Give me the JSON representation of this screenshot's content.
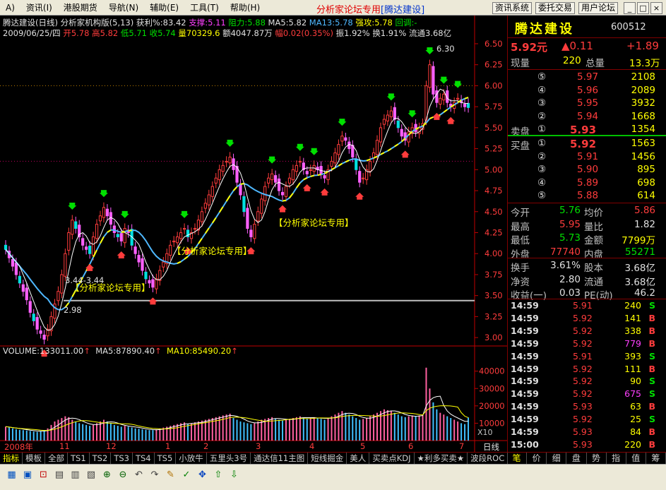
{
  "menu": {
    "items": [
      "A)",
      "资讯(I)",
      "港股期货",
      "导航(N)",
      "辅助(E)",
      "工具(T)",
      "帮助(H)"
    ],
    "title": "分析家论坛专用",
    "title_symbol": "[腾达建设]",
    "right_buttons": [
      "资讯系统",
      "委托交易",
      "用户论坛"
    ],
    "window_buttons": [
      "_",
      "□",
      "×"
    ]
  },
  "chart_info": {
    "name_period": "腾达建设(日线)",
    "indicator": "分析家机构版(5,13)",
    "profit": "获利%:83.42",
    "support": "支撑:5.11",
    "resistance": "阻力:5.88",
    "ma5": "MA5:5.82",
    "ma13": "MA13:5.78",
    "strong": "强攻:5.78",
    "pullback": "回调:-",
    "date": "2009/06/25/四",
    "open": "开5.78",
    "high": "高5.82",
    "low": "低5.71",
    "close": "收5.74",
    "volume": "量70329.6",
    "amount": "额4047.87万",
    "range": "幅0.02(0.35%)",
    "amp": "振1.92%",
    "turnover": "换1.91%",
    "float": "流通3.68亿"
  },
  "annotations": {
    "top_label": "6.30",
    "low_label": "2.98",
    "line_label": "3.44-3.44",
    "forum1": "【分析家论坛专用】",
    "forum2": "【分析家论坛专用】",
    "forum3": "【分析家论坛专用】"
  },
  "volume_info": {
    "volume": "VOLUME:133011.00",
    "ma5": "MA5:87890.40",
    "ma10": "MA10:85490.20"
  },
  "vol_multiplier": "X10",
  "date_axis": [
    "2008年",
    "11",
    "12",
    "1",
    "2",
    "3",
    "4",
    "5",
    "6",
    "7"
  ],
  "date_axis_right": "日线",
  "colors": {
    "up": "#ff3c3c",
    "down": "#00e000",
    "ma5": "#ffffff",
    "ma13": "#ffff00",
    "ma_support": "#4fb8ff",
    "axis": "#c00000"
  },
  "chart_data": {
    "type": "candlestick",
    "ylim": [
      2.9,
      6.55
    ],
    "yticks": [
      3.0,
      3.25,
      3.5,
      3.75,
      4.0,
      4.25,
      4.5,
      4.75,
      5.0,
      5.25,
      5.5,
      5.75,
      6.0,
      6.25,
      6.5
    ],
    "vol_yticks": [
      10000,
      20000,
      30000,
      40000
    ],
    "vol_ylim": [
      0,
      48000
    ],
    "horizontal_line": 3.44,
    "closes": [
      4.05,
      3.95,
      3.85,
      3.75,
      3.65,
      3.55,
      3.45,
      3.3,
      3.2,
      3.1,
      3.05,
      2.98,
      3.1,
      3.25,
      3.4,
      3.55,
      3.75,
      4.0,
      4.25,
      4.4,
      4.3,
      4.2,
      4.1,
      4.05,
      4.0,
      4.2,
      4.35,
      4.45,
      4.55,
      4.45,
      4.35,
      4.25,
      4.2,
      4.15,
      4.3,
      4.25,
      4.1,
      4.0,
      3.9,
      3.8,
      3.7,
      3.65,
      3.6,
      3.7,
      3.8,
      3.9,
      4.0,
      4.1,
      4.15,
      4.2,
      4.25,
      4.3,
      4.2,
      4.25,
      4.3,
      4.4,
      4.5,
      4.6,
      4.7,
      4.8,
      4.9,
      5.0,
      5.05,
      5.1,
      5.15,
      5.0,
      4.85,
      4.7,
      4.5,
      4.3,
      4.2,
      4.35,
      4.5,
      4.65,
      4.8,
      4.9,
      4.95,
      4.85,
      4.75,
      4.7,
      4.8,
      4.9,
      5.0,
      5.05,
      5.1,
      5.0,
      4.95,
      5.0,
      5.05,
      5.0,
      4.95,
      4.9,
      5.0,
      5.1,
      5.2,
      5.3,
      5.4,
      5.35,
      5.25,
      5.15,
      5.0,
      4.85,
      4.9,
      5.0,
      5.1,
      5.2,
      5.35,
      5.5,
      5.6,
      5.65,
      5.7,
      5.6,
      5.5,
      5.4,
      5.35,
      5.45,
      5.5,
      5.45,
      5.5,
      5.55,
      6.0,
      6.25,
      5.9,
      5.8,
      5.85,
      5.9,
      5.8,
      5.75,
      5.8,
      5.85,
      5.8,
      5.75,
      5.74
    ],
    "volumes": [
      8000,
      7500,
      7000,
      6500,
      6200,
      6000,
      5800,
      5500,
      5200,
      5000,
      5500,
      6000,
      7000,
      9000,
      11000,
      12000,
      13000,
      14000,
      13500,
      12000,
      11000,
      10000,
      9500,
      9000,
      8500,
      9000,
      10000,
      11000,
      12000,
      11000,
      10000,
      9000,
      8500,
      8000,
      8500,
      8000,
      7500,
      7000,
      6800,
      6500,
      6200,
      6000,
      6000,
      6500,
      7000,
      7500,
      8000,
      8500,
      9000,
      9500,
      10000,
      10500,
      9500,
      10000,
      10500,
      11000,
      11500,
      12000,
      12500,
      13000,
      13500,
      14000,
      14500,
      15000,
      15500,
      13000,
      12000,
      11000,
      10500,
      10000,
      9500,
      10000,
      11000,
      12000,
      12500,
      13000,
      13500,
      12500,
      12000,
      11500,
      12000,
      12500,
      13000,
      13500,
      14000,
      13000,
      12500,
      13000,
      13500,
      13000,
      12500,
      12000,
      13000,
      14000,
      15000,
      16000,
      17000,
      16000,
      15000,
      14000,
      13000,
      12000,
      12500,
      13000,
      14000,
      15000,
      16000,
      17000,
      18000,
      17500,
      17000,
      16000,
      15000,
      14000,
      13500,
      14000,
      14500,
      14000,
      14500,
      15000,
      42000,
      30000,
      22000,
      18000,
      16000,
      15000,
      14000,
      13000,
      12000,
      11000,
      10000,
      9500,
      13300
    ]
  },
  "right_panel": {
    "name": "腾达建设",
    "code": "600512",
    "price": "5.92元",
    "change": "▲0.11",
    "change_pct": "+1.89",
    "now_vol_label": "现量",
    "now_vol": "220",
    "total_label": "总量",
    "total": "13.3万",
    "asks": [
      {
        "n": "⑤",
        "p": "5.97",
        "v": "2108"
      },
      {
        "n": "④",
        "p": "5.96",
        "v": "2089"
      },
      {
        "n": "③",
        "p": "5.95",
        "v": "3932"
      },
      {
        "n": "②",
        "p": "5.94",
        "v": "1668"
      },
      {
        "n": "①",
        "p": "5.93",
        "v": "1354"
      }
    ],
    "sell_label": "卖盘",
    "buy_label": "买盘",
    "bids": [
      {
        "n": "①",
        "p": "5.92",
        "v": "1563"
      },
      {
        "n": "②",
        "p": "5.91",
        "v": "1456"
      },
      {
        "n": "③",
        "p": "5.90",
        "v": "895"
      },
      {
        "n": "④",
        "p": "5.89",
        "v": "698"
      },
      {
        "n": "⑤",
        "p": "5.88",
        "v": "614"
      }
    ],
    "stats": [
      {
        "l1": "今开",
        "v1": "5.76",
        "l2": "均价",
        "v2": "5.86"
      },
      {
        "l1": "最高",
        "v1": "5.95",
        "l2": "量比",
        "v2": "1.82"
      },
      {
        "l1": "最低",
        "v1": "5.73",
        "l2": "金额",
        "v2": "7799万"
      },
      {
        "l1": "外盘",
        "v1": "77740",
        "l2": "内盘",
        "v2": "55271"
      }
    ],
    "stats2": [
      {
        "l1": "换手",
        "v1": "3.61%",
        "l2": "股本",
        "v2": "3.68亿"
      },
      {
        "l1": "净资",
        "v1": "2.80",
        "l2": "流通",
        "v2": "3.68亿"
      },
      {
        "l1": "收益(一)",
        "v1": "0.03",
        "l2": "PE(动)",
        "v2": "46.2"
      }
    ],
    "ticks": [
      {
        "t": "14:59",
        "p": "5.91",
        "v": "240",
        "s": "S"
      },
      {
        "t": "14:59",
        "p": "5.92",
        "v": "141",
        "s": "B"
      },
      {
        "t": "14:59",
        "p": "5.92",
        "v": "338",
        "s": "B"
      },
      {
        "t": "14:59",
        "p": "5.92",
        "v": "779",
        "s": "B"
      },
      {
        "t": "14:59",
        "p": "5.91",
        "v": "393",
        "s": "S"
      },
      {
        "t": "14:59",
        "p": "5.92",
        "v": "111",
        "s": "B"
      },
      {
        "t": "14:59",
        "p": "5.92",
        "v": "90",
        "s": "S"
      },
      {
        "t": "14:59",
        "p": "5.92",
        "v": "675",
        "s": "S"
      },
      {
        "t": "14:59",
        "p": "5.93",
        "v": "63",
        "s": "B"
      },
      {
        "t": "14:59",
        "p": "5.92",
        "v": "25",
        "s": "S"
      },
      {
        "t": "14:59",
        "p": "5.93",
        "v": "84",
        "s": "B"
      },
      {
        "t": "15:00",
        "p": "5.93",
        "v": "220",
        "s": "B"
      }
    ]
  },
  "bottom_tabs": [
    "指标",
    "模板",
    "全部",
    "TS1",
    "TS2",
    "TS3",
    "TS4",
    "TS5",
    "小放牛",
    "五里头3号",
    "通达信11主图",
    "短线掘金",
    "美人",
    "买卖点KDJ",
    "★利多买卖★",
    "波段ROC"
  ],
  "right_tabs": [
    "笔",
    "价",
    "细",
    "盘",
    "势",
    "指",
    "值",
    "筹"
  ],
  "toolbar_icons": [
    "chart-icon",
    "window-icon",
    "f10-icon",
    "grid-icon",
    "bar-icon",
    "list-icon",
    "zoom-in-icon",
    "zoom-out-icon",
    "back-icon",
    "forward-icon",
    "pencil-icon",
    "check-icon",
    "move-icon",
    "up-icon",
    "down-icon"
  ],
  "toolbar_glyphs": [
    "▦",
    "▣",
    "⊡",
    "▤",
    "▥",
    "▧",
    "⊕",
    "⊖",
    "↶",
    "↷",
    "✎",
    "✓",
    "✥",
    "⇧",
    "⇩"
  ]
}
